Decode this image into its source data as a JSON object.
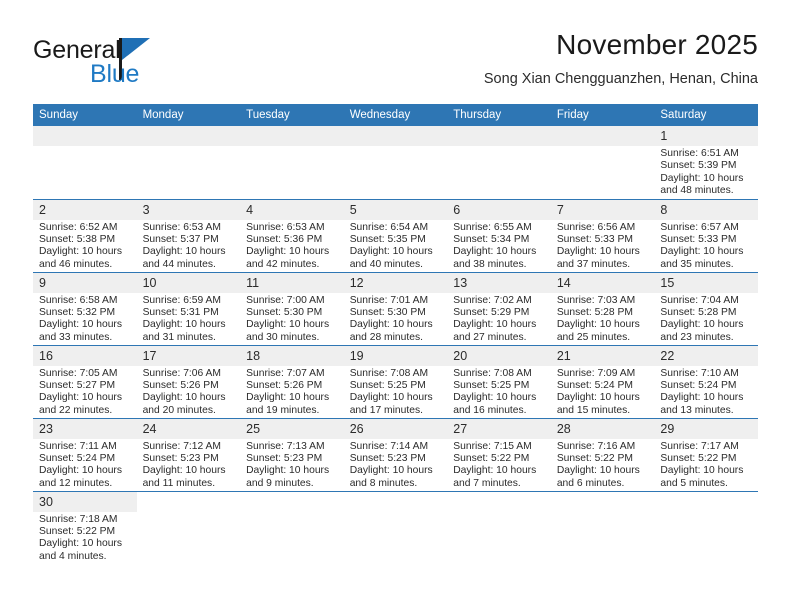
{
  "brand": {
    "name_top": "General",
    "name_bottom": "Blue",
    "accent_color": "#1f7ac4",
    "triangle_color": "#1f6fb5"
  },
  "header": {
    "title": "November 2025",
    "subtitle": "Song Xian Chengguanzhen, Henan, China"
  },
  "theme": {
    "header_blue": "#2e76b4",
    "daynum_bg": "#efefef",
    "text_color": "#2b2b2b"
  },
  "weekdays": [
    "Sunday",
    "Monday",
    "Tuesday",
    "Wednesday",
    "Thursday",
    "Friday",
    "Saturday"
  ],
  "weeks": [
    [
      {
        "blank": true
      },
      {
        "blank": true
      },
      {
        "blank": true
      },
      {
        "blank": true
      },
      {
        "blank": true
      },
      {
        "blank": true
      },
      {
        "day": "1",
        "sunrise": "Sunrise: 6:51 AM",
        "sunset": "Sunset: 5:39 PM",
        "daylight1": "Daylight: 10 hours",
        "daylight2": "and 48 minutes."
      }
    ],
    [
      {
        "day": "2",
        "sunrise": "Sunrise: 6:52 AM",
        "sunset": "Sunset: 5:38 PM",
        "daylight1": "Daylight: 10 hours",
        "daylight2": "and 46 minutes."
      },
      {
        "day": "3",
        "sunrise": "Sunrise: 6:53 AM",
        "sunset": "Sunset: 5:37 PM",
        "daylight1": "Daylight: 10 hours",
        "daylight2": "and 44 minutes."
      },
      {
        "day": "4",
        "sunrise": "Sunrise: 6:53 AM",
        "sunset": "Sunset: 5:36 PM",
        "daylight1": "Daylight: 10 hours",
        "daylight2": "and 42 minutes."
      },
      {
        "day": "5",
        "sunrise": "Sunrise: 6:54 AM",
        "sunset": "Sunset: 5:35 PM",
        "daylight1": "Daylight: 10 hours",
        "daylight2": "and 40 minutes."
      },
      {
        "day": "6",
        "sunrise": "Sunrise: 6:55 AM",
        "sunset": "Sunset: 5:34 PM",
        "daylight1": "Daylight: 10 hours",
        "daylight2": "and 38 minutes."
      },
      {
        "day": "7",
        "sunrise": "Sunrise: 6:56 AM",
        "sunset": "Sunset: 5:33 PM",
        "daylight1": "Daylight: 10 hours",
        "daylight2": "and 37 minutes."
      },
      {
        "day": "8",
        "sunrise": "Sunrise: 6:57 AM",
        "sunset": "Sunset: 5:33 PM",
        "daylight1": "Daylight: 10 hours",
        "daylight2": "and 35 minutes."
      }
    ],
    [
      {
        "day": "9",
        "sunrise": "Sunrise: 6:58 AM",
        "sunset": "Sunset: 5:32 PM",
        "daylight1": "Daylight: 10 hours",
        "daylight2": "and 33 minutes."
      },
      {
        "day": "10",
        "sunrise": "Sunrise: 6:59 AM",
        "sunset": "Sunset: 5:31 PM",
        "daylight1": "Daylight: 10 hours",
        "daylight2": "and 31 minutes."
      },
      {
        "day": "11",
        "sunrise": "Sunrise: 7:00 AM",
        "sunset": "Sunset: 5:30 PM",
        "daylight1": "Daylight: 10 hours",
        "daylight2": "and 30 minutes."
      },
      {
        "day": "12",
        "sunrise": "Sunrise: 7:01 AM",
        "sunset": "Sunset: 5:30 PM",
        "daylight1": "Daylight: 10 hours",
        "daylight2": "and 28 minutes."
      },
      {
        "day": "13",
        "sunrise": "Sunrise: 7:02 AM",
        "sunset": "Sunset: 5:29 PM",
        "daylight1": "Daylight: 10 hours",
        "daylight2": "and 27 minutes."
      },
      {
        "day": "14",
        "sunrise": "Sunrise: 7:03 AM",
        "sunset": "Sunset: 5:28 PM",
        "daylight1": "Daylight: 10 hours",
        "daylight2": "and 25 minutes."
      },
      {
        "day": "15",
        "sunrise": "Sunrise: 7:04 AM",
        "sunset": "Sunset: 5:28 PM",
        "daylight1": "Daylight: 10 hours",
        "daylight2": "and 23 minutes."
      }
    ],
    [
      {
        "day": "16",
        "sunrise": "Sunrise: 7:05 AM",
        "sunset": "Sunset: 5:27 PM",
        "daylight1": "Daylight: 10 hours",
        "daylight2": "and 22 minutes."
      },
      {
        "day": "17",
        "sunrise": "Sunrise: 7:06 AM",
        "sunset": "Sunset: 5:26 PM",
        "daylight1": "Daylight: 10 hours",
        "daylight2": "and 20 minutes."
      },
      {
        "day": "18",
        "sunrise": "Sunrise: 7:07 AM",
        "sunset": "Sunset: 5:26 PM",
        "daylight1": "Daylight: 10 hours",
        "daylight2": "and 19 minutes."
      },
      {
        "day": "19",
        "sunrise": "Sunrise: 7:08 AM",
        "sunset": "Sunset: 5:25 PM",
        "daylight1": "Daylight: 10 hours",
        "daylight2": "and 17 minutes."
      },
      {
        "day": "20",
        "sunrise": "Sunrise: 7:08 AM",
        "sunset": "Sunset: 5:25 PM",
        "daylight1": "Daylight: 10 hours",
        "daylight2": "and 16 minutes."
      },
      {
        "day": "21",
        "sunrise": "Sunrise: 7:09 AM",
        "sunset": "Sunset: 5:24 PM",
        "daylight1": "Daylight: 10 hours",
        "daylight2": "and 15 minutes."
      },
      {
        "day": "22",
        "sunrise": "Sunrise: 7:10 AM",
        "sunset": "Sunset: 5:24 PM",
        "daylight1": "Daylight: 10 hours",
        "daylight2": "and 13 minutes."
      }
    ],
    [
      {
        "day": "23",
        "sunrise": "Sunrise: 7:11 AM",
        "sunset": "Sunset: 5:24 PM",
        "daylight1": "Daylight: 10 hours",
        "daylight2": "and 12 minutes."
      },
      {
        "day": "24",
        "sunrise": "Sunrise: 7:12 AM",
        "sunset": "Sunset: 5:23 PM",
        "daylight1": "Daylight: 10 hours",
        "daylight2": "and 11 minutes."
      },
      {
        "day": "25",
        "sunrise": "Sunrise: 7:13 AM",
        "sunset": "Sunset: 5:23 PM",
        "daylight1": "Daylight: 10 hours",
        "daylight2": "and 9 minutes."
      },
      {
        "day": "26",
        "sunrise": "Sunrise: 7:14 AM",
        "sunset": "Sunset: 5:23 PM",
        "daylight1": "Daylight: 10 hours",
        "daylight2": "and 8 minutes."
      },
      {
        "day": "27",
        "sunrise": "Sunrise: 7:15 AM",
        "sunset": "Sunset: 5:22 PM",
        "daylight1": "Daylight: 10 hours",
        "daylight2": "and 7 minutes."
      },
      {
        "day": "28",
        "sunrise": "Sunrise: 7:16 AM",
        "sunset": "Sunset: 5:22 PM",
        "daylight1": "Daylight: 10 hours",
        "daylight2": "and 6 minutes."
      },
      {
        "day": "29",
        "sunrise": "Sunrise: 7:17 AM",
        "sunset": "Sunset: 5:22 PM",
        "daylight1": "Daylight: 10 hours",
        "daylight2": "and 5 minutes."
      }
    ],
    [
      {
        "day": "30",
        "sunrise": "Sunrise: 7:18 AM",
        "sunset": "Sunset: 5:22 PM",
        "daylight1": "Daylight: 10 hours",
        "daylight2": "and 4 minutes."
      },
      {
        "empty": true
      },
      {
        "empty": true
      },
      {
        "empty": true
      },
      {
        "empty": true
      },
      {
        "empty": true
      },
      {
        "empty": true
      }
    ]
  ]
}
